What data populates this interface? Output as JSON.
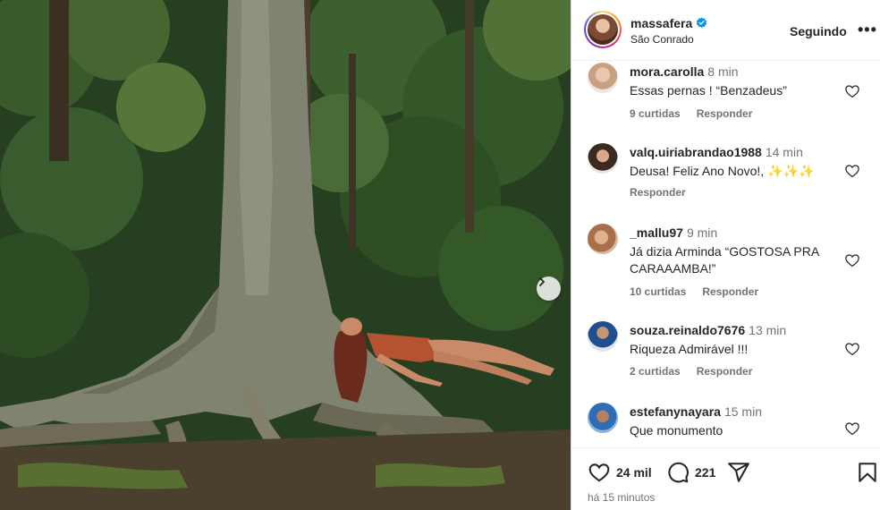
{
  "post": {
    "username": "massafera",
    "location": "São Conrado",
    "follow_label": "Seguindo",
    "more_label": "•••",
    "verified": true
  },
  "comments": [
    {
      "user": "mora.carolla",
      "time": "8 min",
      "text": "Essas pernas ! “Benzadeus”",
      "likes": "9 curtidas",
      "reply": "Responder"
    },
    {
      "user": "valq.uiriabrandao1988",
      "time": "14 min",
      "text": "Deusa! Feliz Ano Novo!, ✨✨✨",
      "likes": "",
      "reply": "Responder"
    },
    {
      "user": "_mallu97",
      "time": "9 min",
      "text": "Já dizia Arminda “GOSTOSA PRA CARAAAMBA!”",
      "likes": "10 curtidas",
      "reply": "Responder"
    },
    {
      "user": "souza.reinaldo7676",
      "time": "13 min",
      "text": "Riqueza Admirável !!!",
      "likes": "2 curtidas",
      "reply": "Responder"
    },
    {
      "user": "estefanynayara",
      "time": "15 min",
      "text": "Que monumento",
      "likes": "",
      "reply": ""
    }
  ],
  "actions": {
    "likes_count": "24 mil",
    "comments_count": "221",
    "posted_ago": "há 15 minutos"
  },
  "icons": [
    "verified-icon",
    "heart-icon",
    "comment-icon",
    "share-icon",
    "bookmark-icon",
    "chevron-right-icon"
  ],
  "colors": {
    "verified_blue": "#0095f6",
    "text": "#262626",
    "muted": "#737373",
    "divider": "#dbdbdb"
  }
}
